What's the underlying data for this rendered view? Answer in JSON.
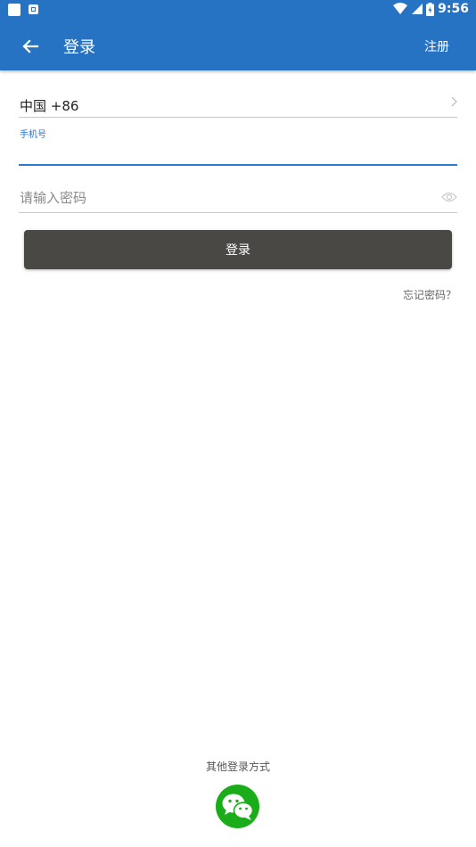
{
  "status_bar": {
    "time": "9:56",
    "icons": [
      "notification-square-icon",
      "notification-a-icon",
      "wifi-icon",
      "cell-signal-icon",
      "battery-icon"
    ]
  },
  "app_bar": {
    "title": "登录",
    "register_label": "注册",
    "back_icon": "back-arrow-icon",
    "background_color": "#2773c3"
  },
  "form": {
    "country_value": "中国 +86",
    "phone_label": "手机号",
    "phone_value": "",
    "password_placeholder": "请输入密码",
    "password_value": "",
    "login_label": "登录",
    "forgot_label": "忘记密码？"
  },
  "footer": {
    "other_methods_label": "其他登录方式",
    "wechat_icon": "wechat-icon",
    "wechat_color": "#1aad19"
  }
}
